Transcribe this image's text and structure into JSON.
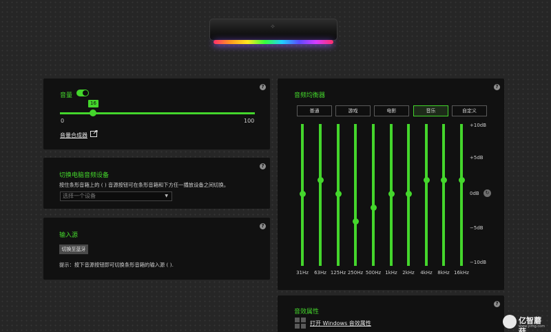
{
  "help_symbol": "?",
  "volume": {
    "title": "音量",
    "enabled": true,
    "value": "16",
    "value_fraction": 0.16,
    "min_label": "0",
    "max_label": "100",
    "mixer_link": "音量合成器"
  },
  "audio_switch": {
    "title": "切换电脑音频设备",
    "description": "按住条形音箱上的 (    ) 音源按钮可在条形音箱和下方任一播放设备之间切换。",
    "dropdown_placeholder": "选择一个设备"
  },
  "input_source": {
    "title": "输入源",
    "button": "切换至蓝牙",
    "hint": "提示：按下音源按钮即可切换条形音箱的输入源 (    )."
  },
  "equalizer": {
    "title": "音频均衡器",
    "presets": [
      "普通",
      "游戏",
      "电影",
      "音乐",
      "自定义"
    ],
    "active_preset": "音乐",
    "db_labels": [
      "+10dB",
      "+5dB",
      "0dB",
      "−5dB",
      "−10dB"
    ],
    "reset_icon": "reset-icon",
    "bands": [
      {
        "freq": "31Hz",
        "gain_db": 0
      },
      {
        "freq": "63Hz",
        "gain_db": 2
      },
      {
        "freq": "125Hz",
        "gain_db": 0
      },
      {
        "freq": "250Hz",
        "gain_db": -4
      },
      {
        "freq": "500Hz",
        "gain_db": -2
      },
      {
        "freq": "1kHz",
        "gain_db": 0
      },
      {
        "freq": "2kHz",
        "gain_db": 0
      },
      {
        "freq": "4kHz",
        "gain_db": 2
      },
      {
        "freq": "8kHz",
        "gain_db": 2
      },
      {
        "freq": "16kHz",
        "gain_db": 2
      }
    ]
  },
  "sound_properties": {
    "title": "音效属性",
    "link": "打开 Windows 音效属性"
  },
  "watermark": {
    "text": "亿智蘑菇",
    "url": "www.yimg.com"
  },
  "colors": {
    "accent": "#44d62c",
    "card_bg": "#111111",
    "page_bg": "#262626"
  }
}
